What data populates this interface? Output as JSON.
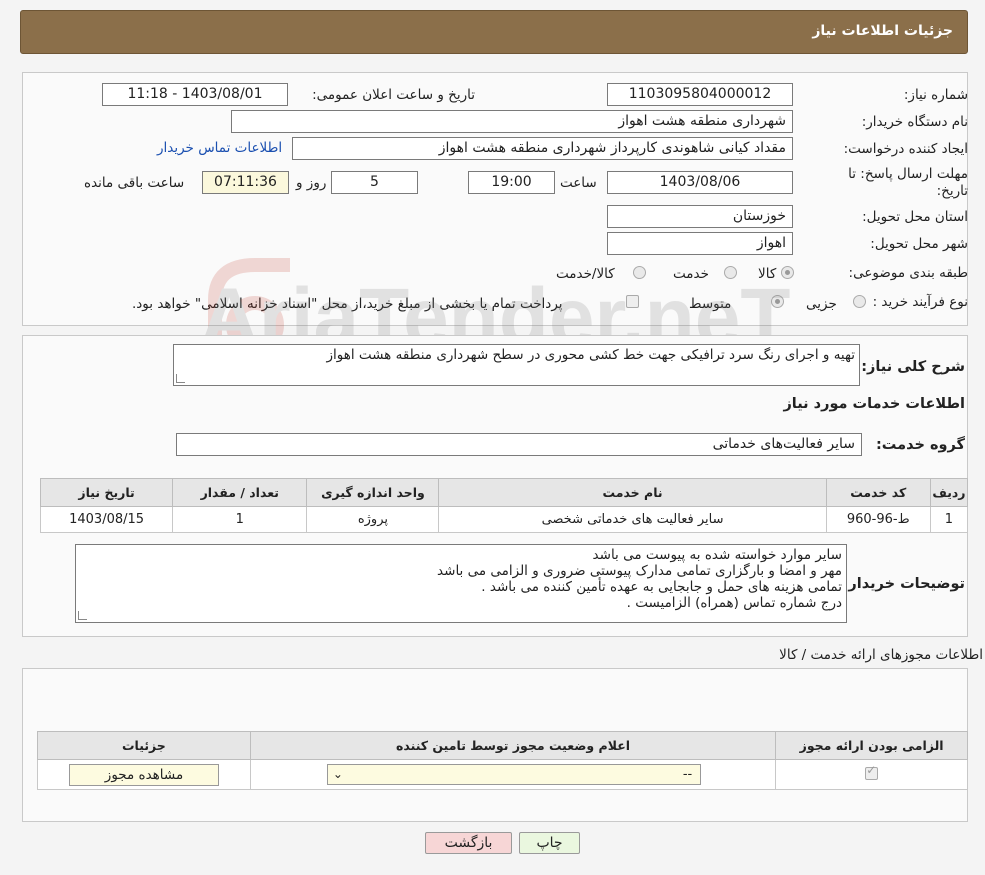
{
  "header": {
    "title": "جزئیات اطلاعات نیاز"
  },
  "form": {
    "need_number_label": "شماره نیاز:",
    "need_number": "1103095804000012",
    "announce_label": "تاریخ و ساعت اعلان عمومی:",
    "announce_value": "1403/08/01 - 11:18",
    "buyer_org_label": "نام دستگاه خریدار:",
    "buyer_org": "شهرداری منطقه هشت اهواز",
    "creator_label": "ایجاد کننده درخواست:",
    "creator": "مقداد کیانی شاهوندی کارپرداز شهرداری منطقه هشت اهواز",
    "contact_link": "اطلاعات تماس خریدار",
    "deadline_label": "مهلت ارسال پاسخ: تا تاریخ:",
    "deadline_date": "1403/08/06",
    "time_label": "ساعت",
    "deadline_time": "19:00",
    "days_value": "5",
    "days_label": "روز و",
    "remaining_time": "07:11:36",
    "remaining_label": "ساعت باقی مانده",
    "province_label": "استان محل تحویل:",
    "province": "خوزستان",
    "city_label": "شهر محل تحویل:",
    "city": "اهواز",
    "category_label": "طبقه بندی موضوعی:",
    "category_options": [
      "کالا",
      "خدمت",
      "کالا/خدمت"
    ],
    "process_label": "نوع فرآیند خرید :",
    "process_options": [
      "جزیی",
      "متوسط"
    ],
    "process_note": "پرداخت تمام یا بخشی از مبلغ خرید،از محل \"اسناد خزانه اسلامی\" خواهد بود."
  },
  "details": {
    "summary_label": "شرح کلی نیاز:",
    "summary": "تهیه و اجرای رنگ سرد ترافیکی جهت خط کشی محوری در سطح شهرداری منطقه هشت اهواز",
    "services_title": "اطلاعات خدمات مورد نیاز",
    "group_label": "گروه خدمت:",
    "group_value": "سایر فعالیت‌های خدماتی",
    "table": {
      "headers": [
        "ردیف",
        "کد خدمت",
        "نام خدمت",
        "واحد اندازه گیری",
        "تعداد / مقدار",
        "تاریخ نیاز"
      ],
      "rows": [
        [
          "1",
          "ط-96-960",
          "سایر فعالیت های خدماتی شخصی",
          "پروژه",
          "1",
          "1403/08/15"
        ]
      ]
    },
    "buyer_notes_label": "توضیحات خریدار:",
    "buyer_notes": [
      "سایر موارد خواسته شده به پیوست می باشد",
      "مهر و امضا و بارگزاری تمامی مدارک پیوستی ضروری و الزامی می باشد",
      "تمامی هزینه های حمل و جابجایی به عهده تأمین کننده می باشد .",
      "درج شماره تماس (همراه) الزامیست ."
    ]
  },
  "licenses": {
    "title": "اطلاعات مجوزهای ارائه خدمت / کالا",
    "headers": [
      "الزامی بودن ارائه مجوز",
      "اعلام وضعیت مجوز توسط تامین کننده",
      "جزئیات"
    ],
    "select_value": "--",
    "view_button": "مشاهده مجوز"
  },
  "buttons": {
    "print": "چاپ",
    "back": "بازگشت"
  },
  "watermark_text": "AriaTender.neT",
  "colors": {
    "header_bg": "#8b6f4a",
    "link": "#1a4fb0",
    "back_btn": "#f7d6d6",
    "print_btn": "#eaf7df",
    "view_btn": "#fdfbe0"
  }
}
